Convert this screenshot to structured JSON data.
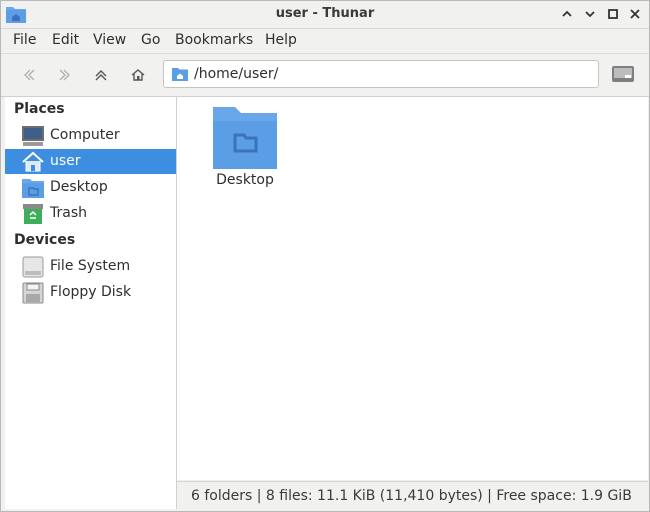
{
  "window": {
    "title": "user - Thunar",
    "controls": [
      "chevron-up-icon",
      "chevron-down-icon",
      "maximize-icon",
      "close-icon"
    ]
  },
  "menubar": {
    "items": [
      "File",
      "Edit",
      "View",
      "Go",
      "Bookmarks",
      "Help"
    ]
  },
  "toolbar": {
    "location": "/home/user/"
  },
  "sidebar": {
    "places_header": "Places",
    "places": [
      {
        "label": "Computer",
        "icon": "computer-icon"
      },
      {
        "label": "user",
        "icon": "home-folder-icon",
        "selected": true
      },
      {
        "label": "Desktop",
        "icon": "desktop-folder-icon"
      },
      {
        "label": "Trash",
        "icon": "trash-icon"
      }
    ],
    "devices_header": "Devices",
    "devices": [
      {
        "label": "File System",
        "icon": "drive-icon"
      },
      {
        "label": "Floppy Disk",
        "icon": "floppy-icon"
      }
    ]
  },
  "content": {
    "items": [
      {
        "label": "Desktop",
        "icon": "folder-icon"
      }
    ]
  },
  "statusbar": {
    "text": "6 folders  |  8 files: 11.1 KiB (11,410 bytes)  |  Free space: 1.9 GiB"
  },
  "colors": {
    "accent": "#3d8ee1",
    "folder": "#5b9ee6"
  }
}
